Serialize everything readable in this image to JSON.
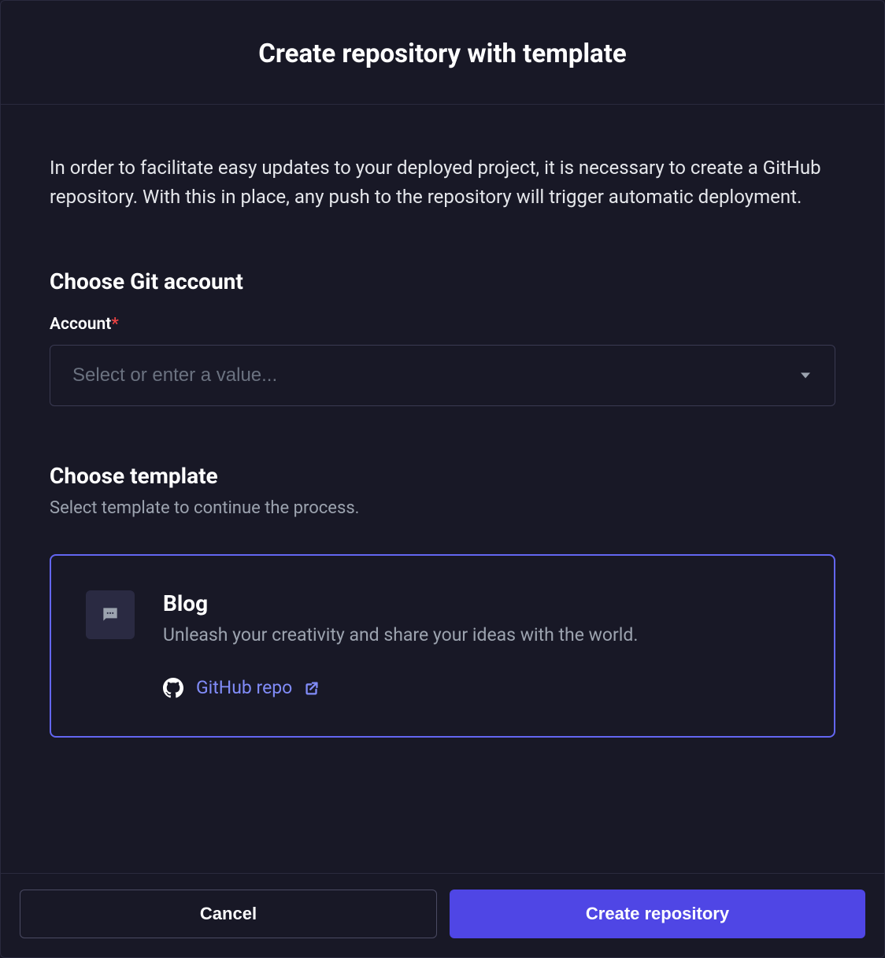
{
  "header": {
    "title": "Create repository with template"
  },
  "intro": "In order to facilitate easy updates to your deployed project, it is necessary to create a GitHub repository. With this in place, any push to the repository will trigger automatic deployment.",
  "account_section": {
    "heading": "Choose Git account",
    "label": "Account",
    "required": "*",
    "placeholder": "Select or enter a value..."
  },
  "template_section": {
    "heading": "Choose template",
    "subtext": "Select template to continue the process.",
    "card": {
      "icon_name": "chat-icon",
      "title": "Blog",
      "description": "Unleash your creativity and share your ideas with the world.",
      "link_label": "GitHub repo"
    }
  },
  "footer": {
    "cancel_label": "Cancel",
    "create_label": "Create repository"
  }
}
